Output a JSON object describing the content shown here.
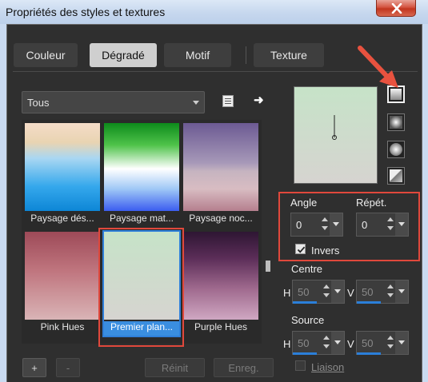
{
  "window": {
    "title": "Propriétés des styles et textures"
  },
  "tabs": [
    {
      "label": "Couleur"
    },
    {
      "label": "Dégradé"
    },
    {
      "label": "Motif"
    },
    {
      "label": "Texture"
    }
  ],
  "library": {
    "selected": "Tous"
  },
  "gradients": [
    {
      "label": "Paysage dés..."
    },
    {
      "label": "Paysage mat..."
    },
    {
      "label": "Paysage noc..."
    },
    {
      "label": "Pink Hues"
    },
    {
      "label": "Premier plan..."
    },
    {
      "label": "Purple Hues"
    }
  ],
  "buttons": {
    "add": "+",
    "remove": "-",
    "reset": "Réinit",
    "save": "Enreg."
  },
  "angle": {
    "label": "Angle",
    "value": "0"
  },
  "repeat": {
    "label": "Répét.",
    "value": "0"
  },
  "invert": {
    "label": "Invers",
    "checked": true
  },
  "center": {
    "label": "Centre",
    "h_label": "H",
    "h_value": "50",
    "v_label": "V",
    "v_value": "50"
  },
  "source": {
    "label": "Source",
    "h_label": "H",
    "h_value": "50",
    "v_label": "V",
    "v_value": "50"
  },
  "link": {
    "label": "Liaison",
    "checked": false
  },
  "colors": {
    "highlight": "#e0483c",
    "selection": "#3a8ee0",
    "accent_arrow": "#e8523f"
  }
}
